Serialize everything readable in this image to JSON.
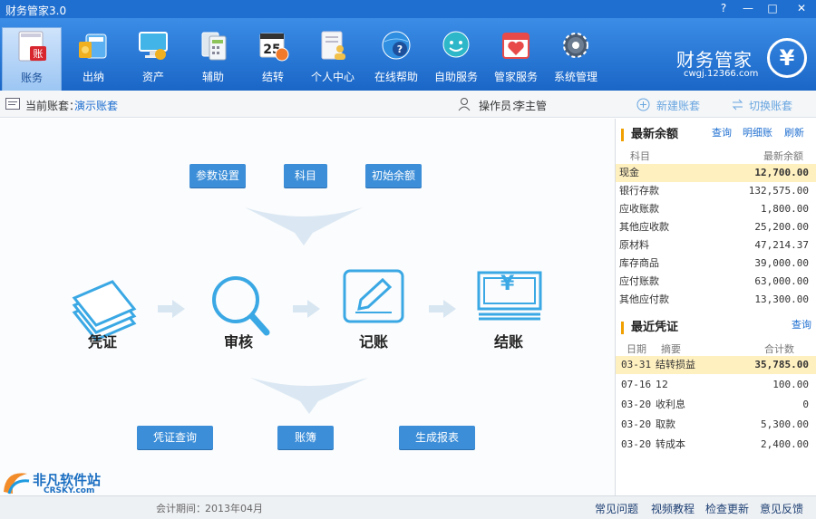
{
  "window": {
    "title": "财务管家3.0",
    "buttons": [
      "?",
      "—",
      "□",
      "✕"
    ]
  },
  "toolbar": {
    "items": [
      {
        "label": "账务",
        "icon": "ledger-icon",
        "color": "#d8262f"
      },
      {
        "label": "出纳",
        "icon": "calculator-icon",
        "color": "#f0b020"
      },
      {
        "label": "资产",
        "icon": "monitor-icon",
        "color": "#42b4e8"
      },
      {
        "label": "辅助",
        "icon": "calculator-grid-icon",
        "color": "#8cc35a"
      },
      {
        "label": "结转",
        "icon": "calendar-icon",
        "color": "#f07a2a"
      },
      {
        "label": "个人中心",
        "icon": "user-document-icon",
        "color": "#f2c14a"
      },
      {
        "label": "在线帮助",
        "icon": "help-globe-icon",
        "color": "#4aa0e8"
      },
      {
        "label": "自助服务",
        "icon": "self-service-icon",
        "color": "#2db7c9"
      },
      {
        "label": "管家服务",
        "icon": "heart-calendar-icon",
        "color": "#e84a4a"
      },
      {
        "label": "系统管理",
        "icon": "gear-icon",
        "color": "#4a5b70"
      }
    ],
    "brand": {
      "name": "财务管家",
      "url": "cwgj.12366.com",
      "logo_glyph": "¥"
    }
  },
  "infobar": {
    "account_label": "当前账套：",
    "account_value": "演示账套",
    "operator_label": "操作员：",
    "operator_value": "李主管",
    "new_account": "新建账套",
    "switch_account": "切换账套"
  },
  "flow": {
    "top_buttons": [
      "参数设置",
      "科目",
      "初始余额"
    ],
    "steps": [
      "凭证",
      "审核",
      "记账",
      "结账"
    ],
    "bottom_buttons": [
      "凭证查询",
      "账簿",
      "生成报表"
    ],
    "yen_glyph": "¥"
  },
  "balance": {
    "title": "最新余额",
    "links": [
      "查询",
      "明细账",
      "刷新"
    ],
    "headers": [
      "科目",
      "最新余额"
    ],
    "rows": [
      {
        "name": "现金",
        "value": "12,700.00"
      },
      {
        "name": "银行存款",
        "value": "132,575.00"
      },
      {
        "name": "应收账款",
        "value": "1,800.00"
      },
      {
        "name": "其他应收款",
        "value": "25,200.00"
      },
      {
        "name": "原材料",
        "value": "47,214.37"
      },
      {
        "name": "库存商品",
        "value": "39,000.00"
      },
      {
        "name": "应付账款",
        "value": "63,000.00"
      },
      {
        "name": "其他应付款",
        "value": "13,300.00"
      }
    ]
  },
  "vouchers": {
    "title": "最近凭证",
    "link": "查询",
    "headers": [
      "日期",
      "摘要",
      "合计数"
    ],
    "rows": [
      {
        "date": "03-31",
        "summary": "结转损益",
        "amount": "35,785.00"
      },
      {
        "date": "07-16",
        "summary": "12",
        "amount": "100.00"
      },
      {
        "date": "03-20",
        "summary": "收利息",
        "amount": "0"
      },
      {
        "date": "03-20",
        "summary": "取款",
        "amount": "5,300.00"
      },
      {
        "date": "03-20",
        "summary": "转成本",
        "amount": "2,400.00"
      }
    ]
  },
  "footer": {
    "period_label": "会计期间：",
    "period_value": "2013年04月",
    "links": [
      "常见问题",
      "视频教程",
      "检查更新",
      "意见反馈"
    ],
    "watermark_cn": "非凡软件站",
    "watermark_en": "CRSKY.com"
  },
  "colors": {
    "toolbar": "#1a66c7",
    "button": "#3c8ed8",
    "highlight": "#fff0c0",
    "accent": "#f0a000"
  }
}
